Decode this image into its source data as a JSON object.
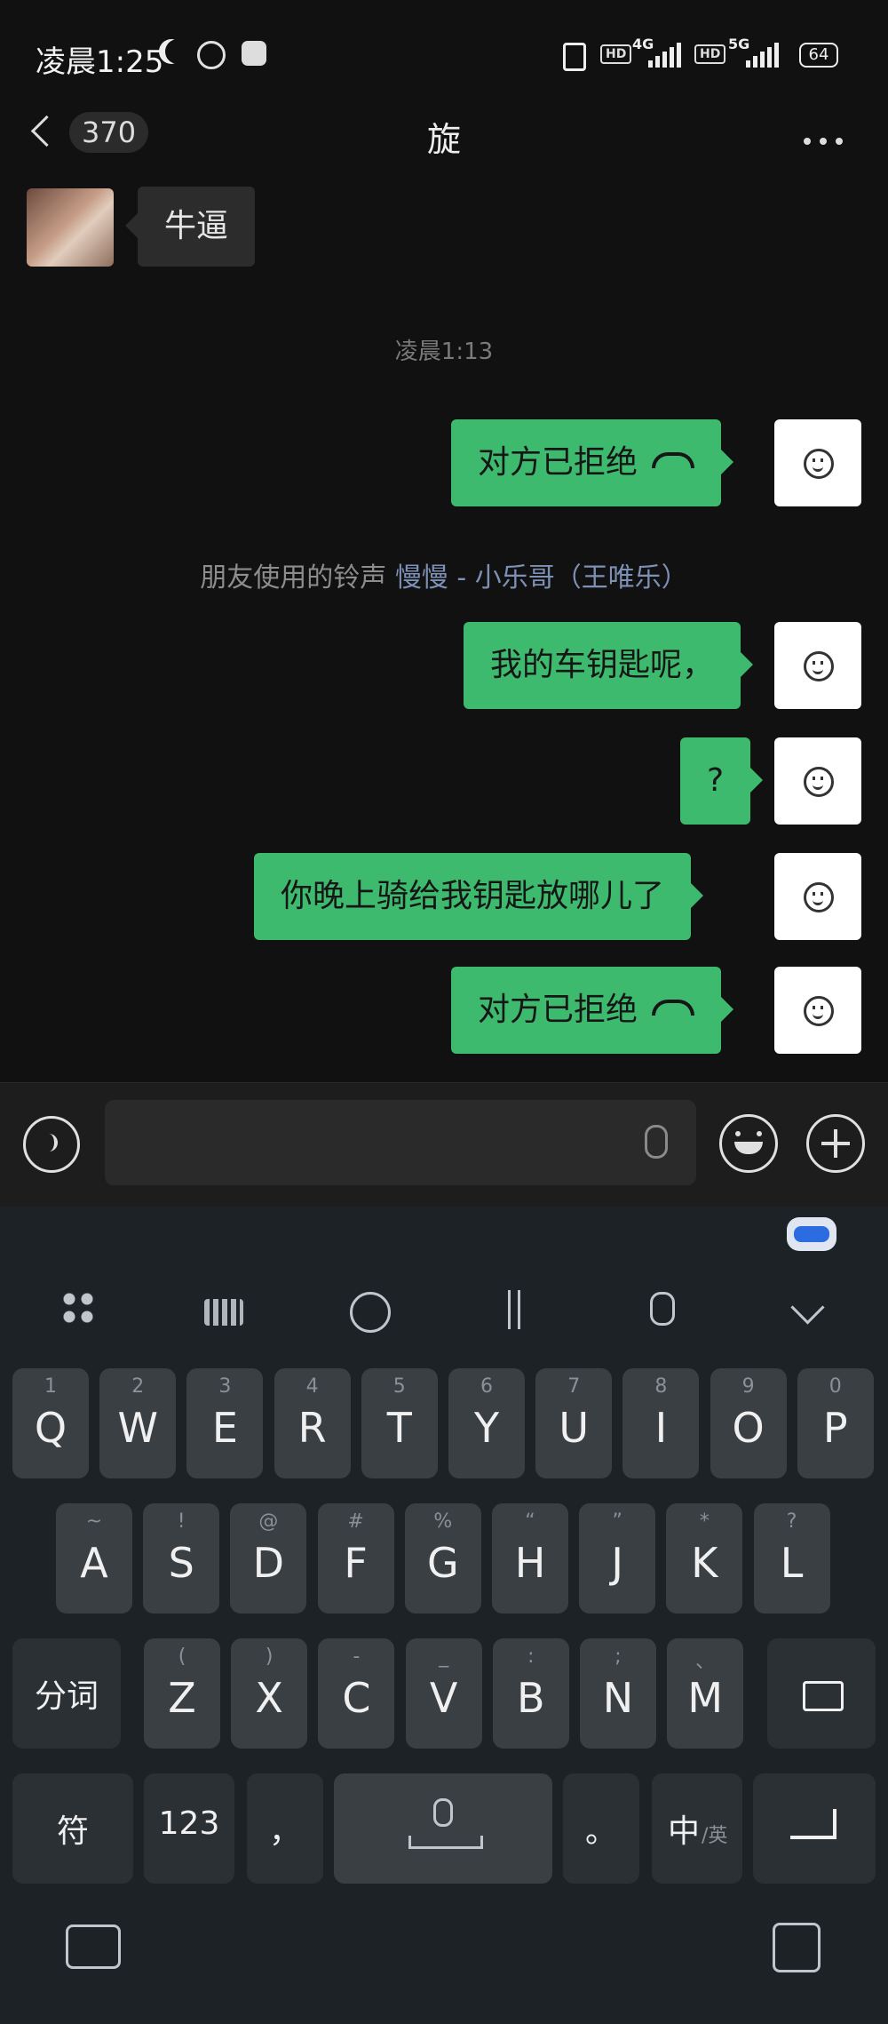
{
  "status_bar": {
    "time": "凌晨1:25",
    "network_a": "4G",
    "network_b": "5G",
    "hd": "HD",
    "battery": "64"
  },
  "header": {
    "back_count": "370",
    "title": "旋"
  },
  "messages": {
    "incoming": "牛逼",
    "timestamp": "凌晨1:13",
    "call_rejected": "对方已拒绝",
    "ringtone_prefix": "朋友使用的铃声",
    "ringtone_song": "慢慢 - 小乐哥（王唯乐）",
    "msg_keys": "我的车钥匙呢，",
    "msg_q": "?",
    "msg_ride": "你晚上骑给我钥匙放哪儿了",
    "call_rejected_2": "对方已拒绝"
  },
  "keyboard": {
    "row1": [
      {
        "k": "Q",
        "s": "1"
      },
      {
        "k": "W",
        "s": "2"
      },
      {
        "k": "E",
        "s": "3"
      },
      {
        "k": "R",
        "s": "4"
      },
      {
        "k": "T",
        "s": "5"
      },
      {
        "k": "Y",
        "s": "6"
      },
      {
        "k": "U",
        "s": "7"
      },
      {
        "k": "I",
        "s": "8"
      },
      {
        "k": "O",
        "s": "9"
      },
      {
        "k": "P",
        "s": "0"
      }
    ],
    "row2": [
      {
        "k": "A",
        "s": "~"
      },
      {
        "k": "S",
        "s": "!"
      },
      {
        "k": "D",
        "s": "@"
      },
      {
        "k": "F",
        "s": "#"
      },
      {
        "k": "G",
        "s": "%"
      },
      {
        "k": "H",
        "s": "“"
      },
      {
        "k": "J",
        "s": "”"
      },
      {
        "k": "K",
        "s": "*"
      },
      {
        "k": "L",
        "s": "?"
      }
    ],
    "row3": [
      {
        "k": "Z",
        "s": "("
      },
      {
        "k": "X",
        "s": ")"
      },
      {
        "k": "C",
        "s": "-"
      },
      {
        "k": "V",
        "s": "_"
      },
      {
        "k": "B",
        "s": ":"
      },
      {
        "k": "N",
        "s": ";"
      },
      {
        "k": "M",
        "s": "、"
      }
    ],
    "fenci": "分词",
    "fu": "符",
    "num": "123",
    "comma": "，",
    "period": "。",
    "zh": "中",
    "en": "/英"
  }
}
